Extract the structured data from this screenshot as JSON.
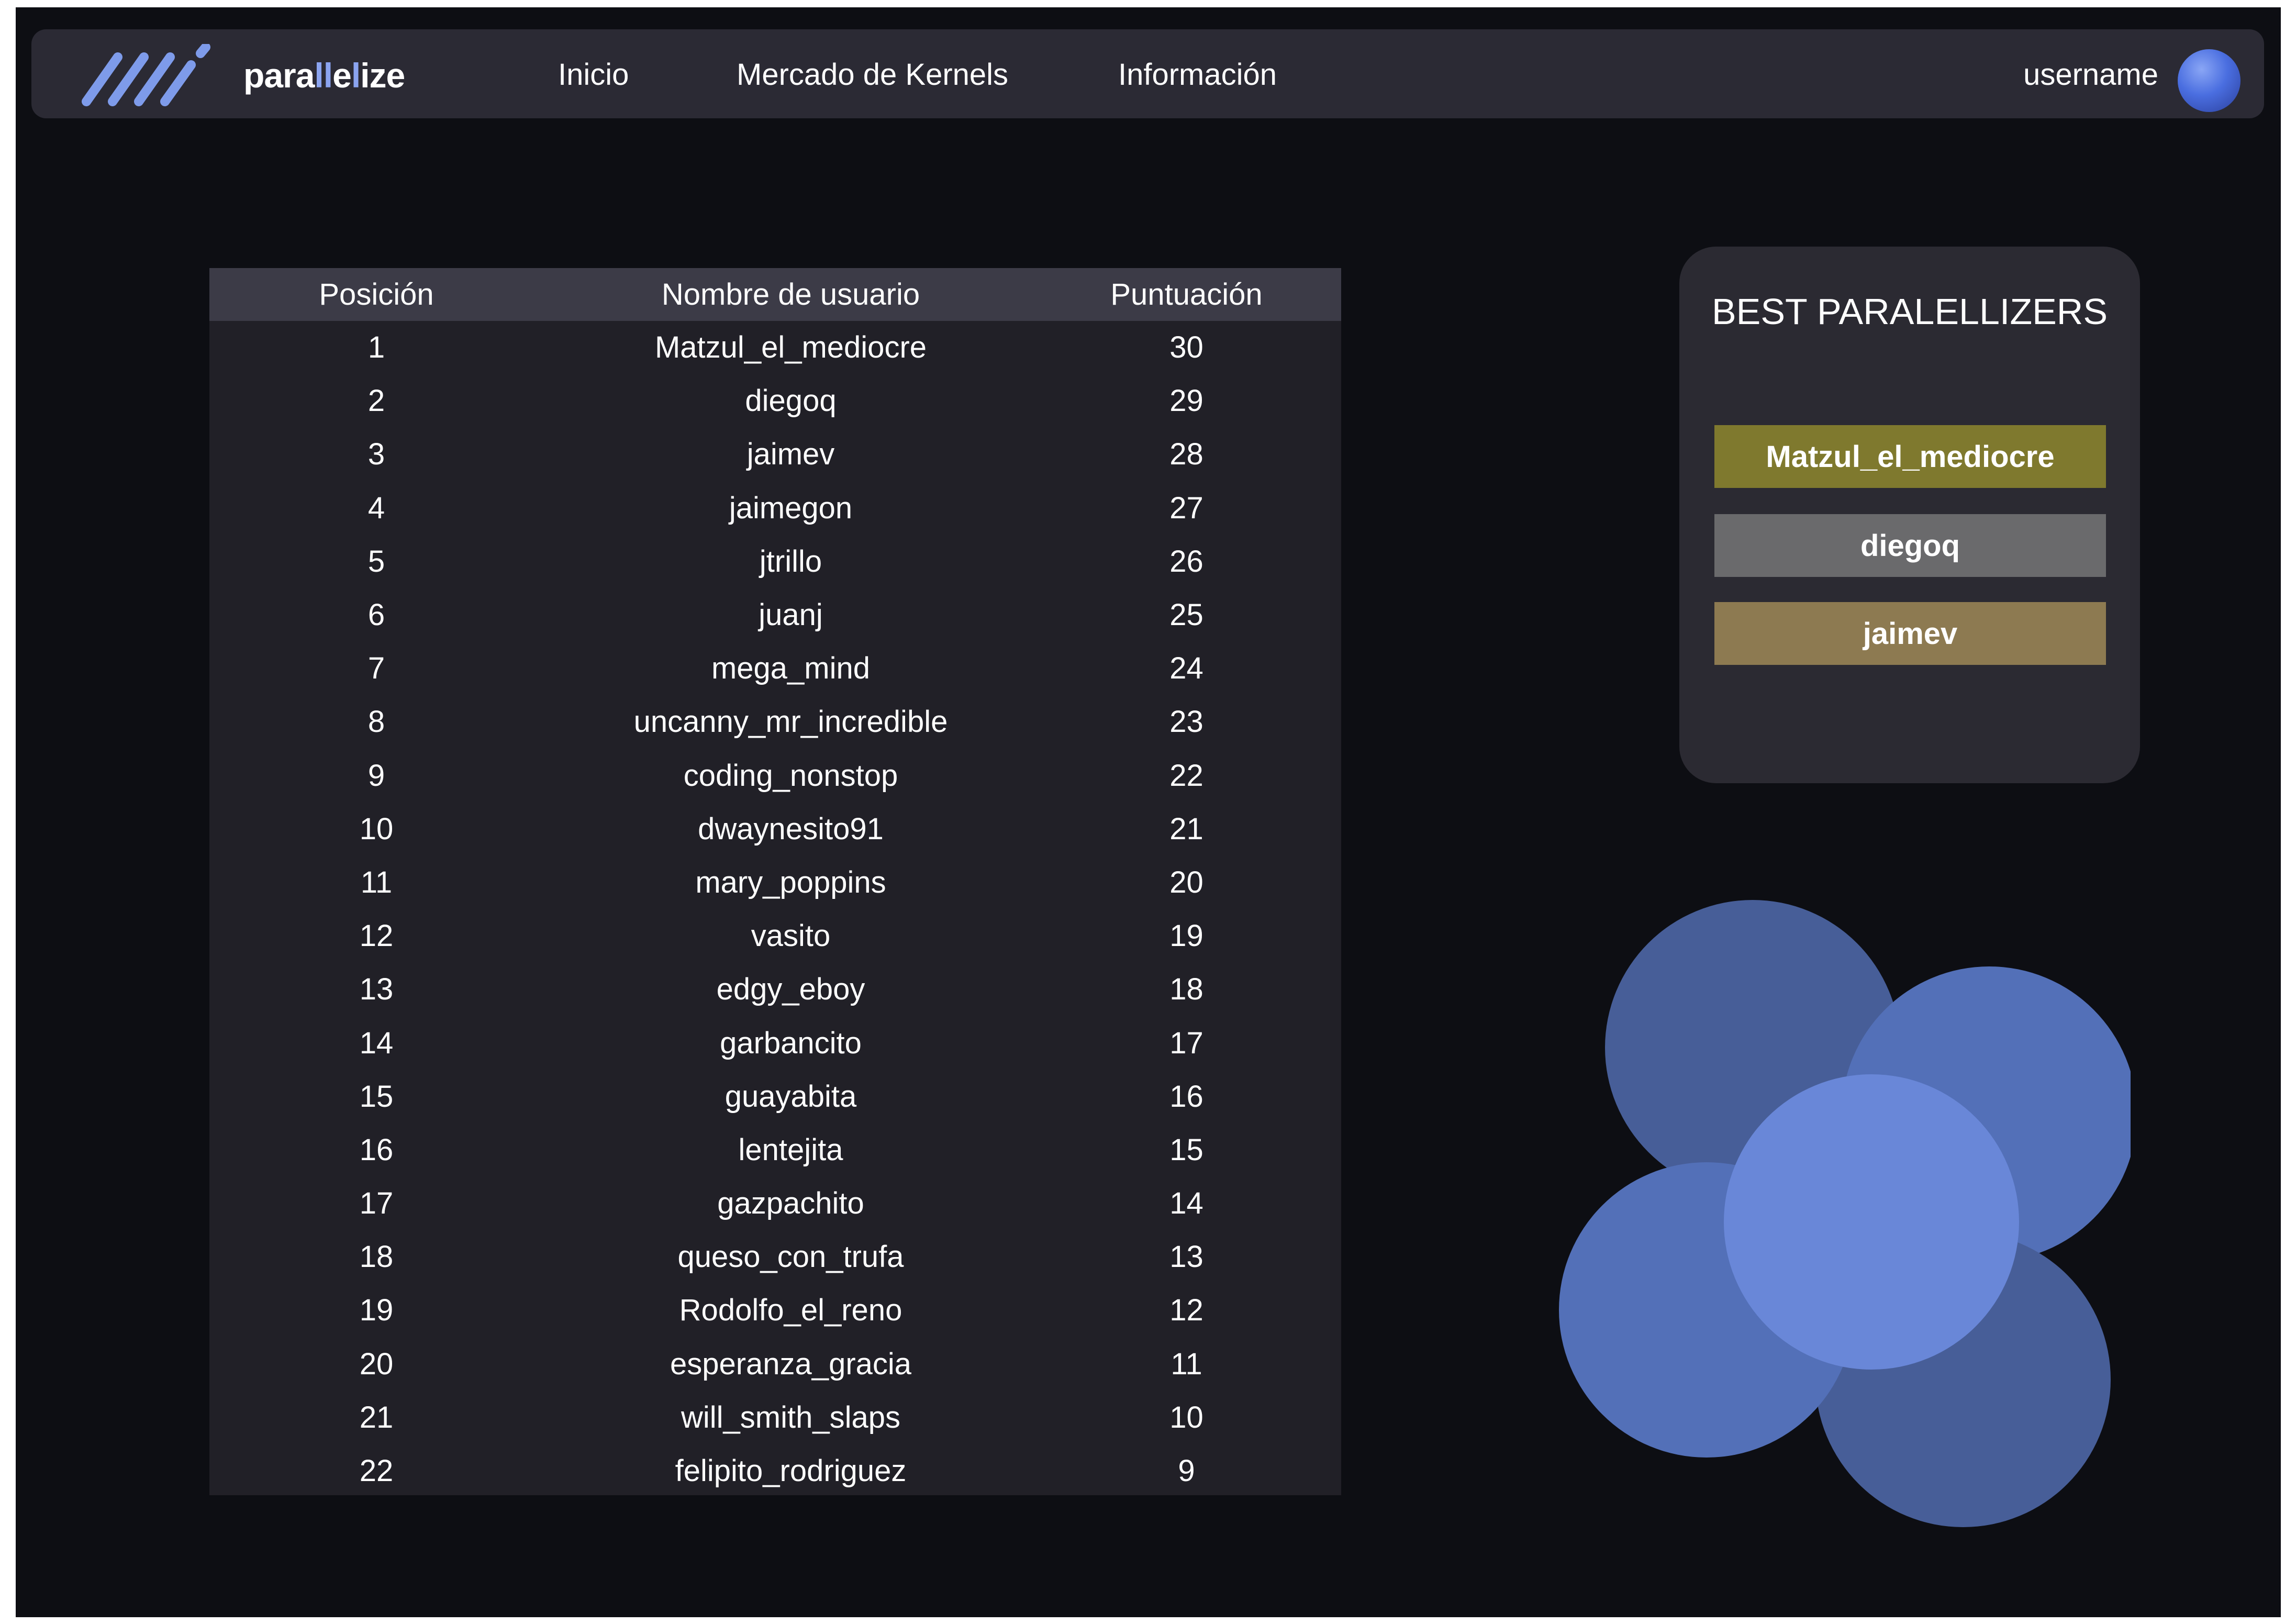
{
  "brand": {
    "name_prefix": "para",
    "name_accent": "ll",
    "name_mid": "e",
    "name_accent2": "l",
    "name_suffix": "ize",
    "accent_color": "#8ba4f0"
  },
  "nav": {
    "links": [
      {
        "label": "Inicio"
      },
      {
        "label": "Mercado de Kernels"
      },
      {
        "label": "Información"
      }
    ]
  },
  "user": {
    "name": "username",
    "avatar_icon": "user-avatar-icon"
  },
  "leaderboard": {
    "headers": {
      "position": "Posición",
      "username": "Nombre de usuario",
      "score": "Puntuación"
    },
    "rows": [
      {
        "pos": "1",
        "name": "Matzul_el_mediocre",
        "score": "30"
      },
      {
        "pos": "2",
        "name": "diegoq",
        "score": "29"
      },
      {
        "pos": "3",
        "name": "jaimev",
        "score": "28"
      },
      {
        "pos": "4",
        "name": "jaimegon",
        "score": "27"
      },
      {
        "pos": "5",
        "name": "jtrillo",
        "score": "26"
      },
      {
        "pos": "6",
        "name": "juanj",
        "score": "25"
      },
      {
        "pos": "7",
        "name": "mega_mind",
        "score": "24"
      },
      {
        "pos": "8",
        "name": "uncanny_mr_incredible",
        "score": "23"
      },
      {
        "pos": "9",
        "name": "coding_nonstop",
        "score": "22"
      },
      {
        "pos": "10",
        "name": "dwaynesito91",
        "score": "21"
      },
      {
        "pos": "11",
        "name": "mary_poppins",
        "score": "20"
      },
      {
        "pos": "12",
        "name": "vasito",
        "score": "19"
      },
      {
        "pos": "13",
        "name": "edgy_eboy",
        "score": "18"
      },
      {
        "pos": "14",
        "name": "garbancito",
        "score": "17"
      },
      {
        "pos": "15",
        "name": "guayabita",
        "score": "16"
      },
      {
        "pos": "16",
        "name": "lentejita",
        "score": "15"
      },
      {
        "pos": "17",
        "name": "gazpachito",
        "score": "14"
      },
      {
        "pos": "18",
        "name": "queso_con_trufa",
        "score": "13"
      },
      {
        "pos": "19",
        "name": "Rodolfo_el_reno",
        "score": "12"
      },
      {
        "pos": "20",
        "name": "esperanza_gracia",
        "score": "11"
      },
      {
        "pos": "21",
        "name": "will_smith_slaps",
        "score": "10"
      },
      {
        "pos": "22",
        "name": "felipito_rodriguez",
        "score": "9"
      }
    ]
  },
  "best": {
    "title": "BEST PARALELLIZERS",
    "gold": "Matzul_el_mediocre",
    "silver": "diegoq",
    "bronze": "jaimev",
    "colors": {
      "gold": "#7f792e",
      "silver": "#6a6a6c",
      "bronze": "#8d7a51"
    }
  },
  "decoration": {
    "icon": "overlapping-circles-icon",
    "colors": [
      "#475e98",
      "#5370b8",
      "#6987d8"
    ]
  }
}
